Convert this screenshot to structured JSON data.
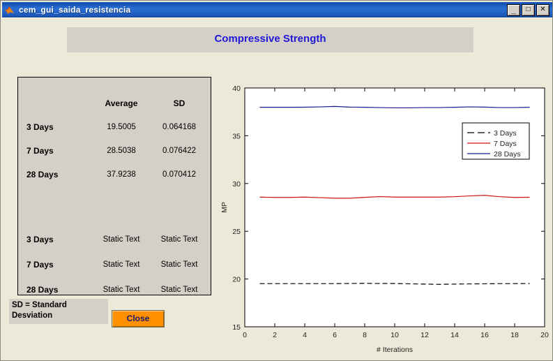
{
  "window": {
    "title": "cem_gui_saida_resistencia",
    "icon": "matlab-icon",
    "minimize_label": "_",
    "maximize_label": "□",
    "close_label": "✕"
  },
  "header": {
    "title": "Compressive Strength",
    "title_color": "#2018d8"
  },
  "results": {
    "columns": [
      "",
      "Average",
      "SD"
    ],
    "rows": [
      {
        "label": "3 Days",
        "average": "19.5005",
        "sd": "0.064168"
      },
      {
        "label": "7 Days",
        "average": "28.5038",
        "sd": "0.076422"
      },
      {
        "label": "28 Days",
        "average": "37.9238",
        "sd": "0.070412"
      }
    ],
    "placeholder_rows": [
      {
        "label": "3 Days",
        "average": "Static Text",
        "sd": "Static Text"
      },
      {
        "label": "7 Days",
        "average": "Static Text",
        "sd": "Static Text"
      },
      {
        "label": "28 Days",
        "average": "Static Text",
        "sd": "Static Text"
      }
    ]
  },
  "note": {
    "text": "SD = Standard\nDesviation"
  },
  "actions": {
    "close_label": "Close",
    "close_color": "#ff9000"
  },
  "chart_data": {
    "type": "line",
    "title": "",
    "xlabel": "# Iterations",
    "ylabel": "MP",
    "xlim": [
      0,
      20
    ],
    "ylim": [
      15,
      40
    ],
    "xticks": [
      0,
      2,
      4,
      6,
      8,
      10,
      12,
      14,
      16,
      18,
      20
    ],
    "yticks": [
      15,
      20,
      25,
      30,
      35,
      40
    ],
    "grid": false,
    "legend_position": "upper-right",
    "x": [
      1,
      2,
      3,
      4,
      5,
      6,
      7,
      8,
      9,
      10,
      11,
      12,
      13,
      14,
      15,
      16,
      17,
      18,
      19
    ],
    "series": [
      {
        "name": "3 Days",
        "color": "#000000",
        "style": "dashed",
        "values": [
          19.52,
          19.52,
          19.52,
          19.52,
          19.52,
          19.52,
          19.53,
          19.55,
          19.53,
          19.53,
          19.5,
          19.47,
          19.44,
          19.47,
          19.49,
          19.5,
          19.52,
          19.52,
          19.53
        ]
      },
      {
        "name": "7 Days",
        "color": "#cc1111",
        "style": "solid",
        "values": [
          28.58,
          28.54,
          28.54,
          28.58,
          28.52,
          28.46,
          28.46,
          28.55,
          28.63,
          28.58,
          28.58,
          28.58,
          28.58,
          28.62,
          28.7,
          28.76,
          28.62,
          28.54,
          28.56
        ]
      },
      {
        "name": "28 Days",
        "color": "#1a1a8c",
        "style": "solid",
        "values": [
          37.98,
          37.98,
          37.98,
          37.99,
          38.02,
          38.07,
          38.0,
          37.98,
          37.95,
          37.92,
          37.92,
          37.95,
          37.95,
          37.98,
          38.02,
          38.0,
          37.95,
          37.95,
          37.98
        ]
      }
    ]
  }
}
